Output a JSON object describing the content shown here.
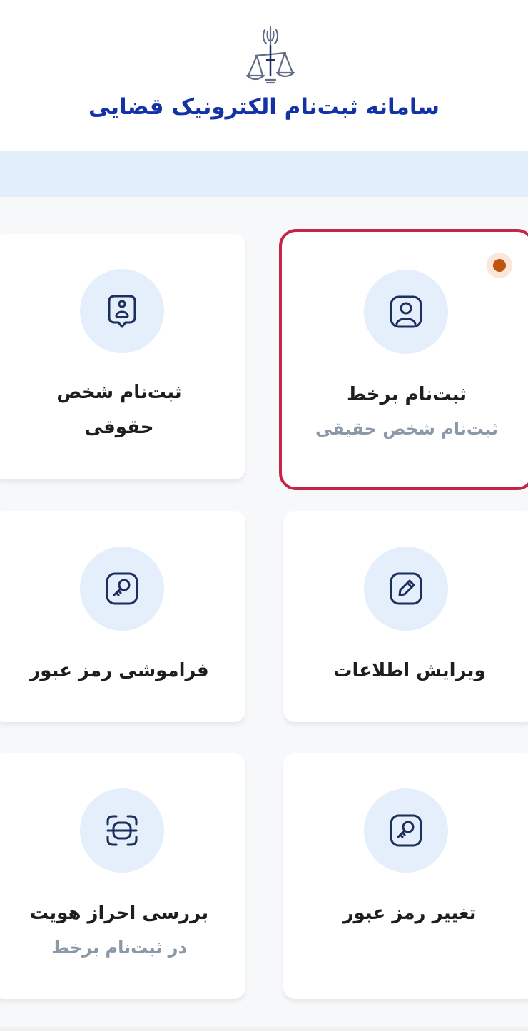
{
  "header": {
    "title": "سامانه ثبت‌نام الکترونیک قضایی",
    "logo_icon": "judiciary-emblem-icon"
  },
  "cards": {
    "online_registration": {
      "title": "ثبت‌نام برخط",
      "subtitle": "ثبت‌نام شخص حقیقی",
      "icon": "user-profile-icon",
      "selected": true,
      "has_notification_dot": true
    },
    "legal_person": {
      "title_line1": "ثبت‌نام شخص",
      "title_line2": "حقوقی",
      "icon": "legal-person-badge-icon"
    },
    "edit_info": {
      "title": "ویرایش اطلاعات",
      "icon": "edit-pencil-icon"
    },
    "forgot_password": {
      "title": "فراموشی رمز عبور",
      "icon": "key-icon"
    },
    "change_password": {
      "title": "تغییر رمز عبور",
      "icon": "key-icon"
    },
    "identity_check": {
      "title": "بررسی احراز هویت",
      "subtitle": "در ثبت‌نام برخط",
      "icon": "face-scan-icon"
    }
  },
  "colors": {
    "title_blue": "#1232a6",
    "icon_navy": "#1c2f5e",
    "selected_border": "#c42647",
    "notification_dot": "#c0540e",
    "icon_circle_bg": "#e5eefb",
    "banner_bg": "#e3eefc"
  }
}
